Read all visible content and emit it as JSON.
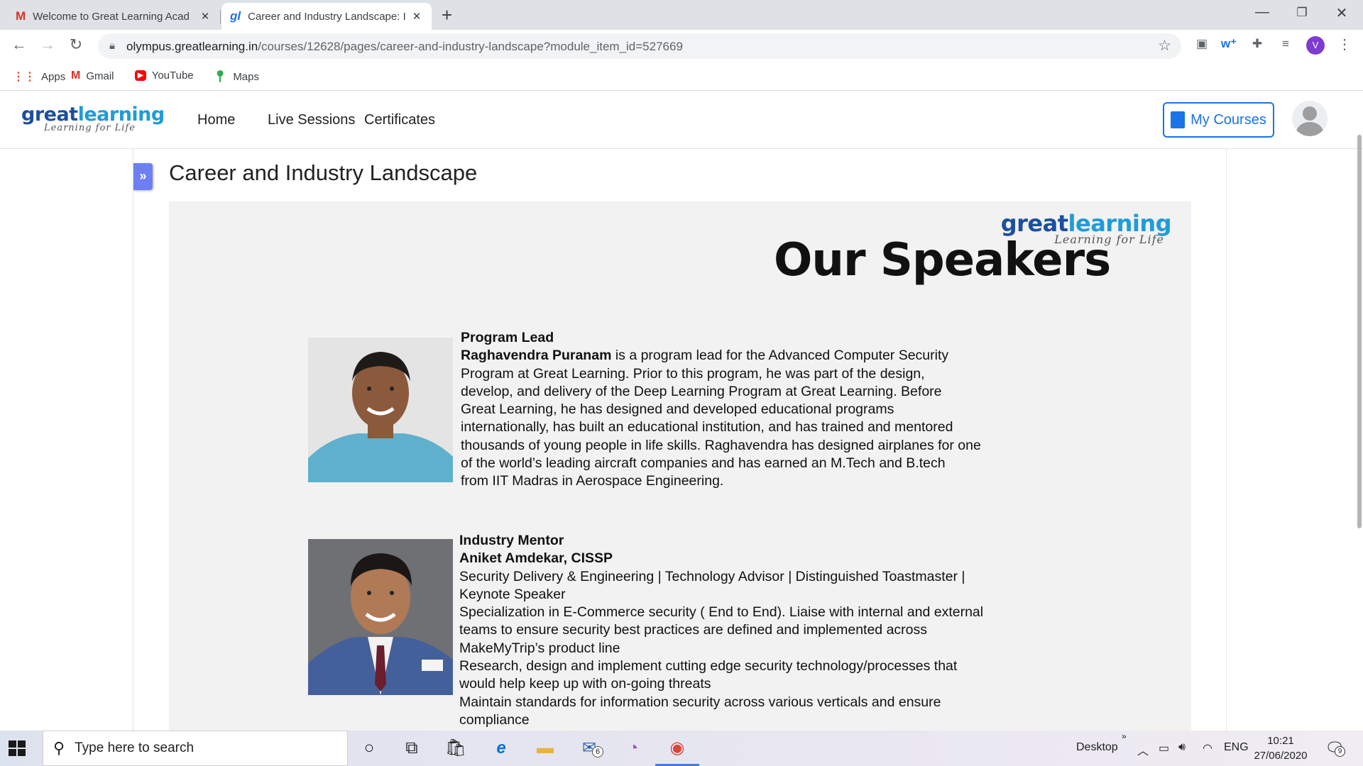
{
  "browser": {
    "tabs": [
      {
        "title": "Welcome to Great Learning Acad",
        "icon": "gmail-icon",
        "active": false
      },
      {
        "title": "Career and Industry Landscape: I",
        "icon": "greatlearning-icon",
        "active": true
      }
    ],
    "url_domain": "olympus.greatlearning.in",
    "url_path": "/courses/12628/pages/career-and-industry-landscape?module_item_id=527669",
    "profile_initial": "V",
    "bookmarks": [
      "Apps",
      "Gmail",
      "YouTube",
      "Maps"
    ]
  },
  "site": {
    "logo_main_a": "great",
    "logo_main_b": "learning",
    "logo_sub": "Learning for Life",
    "nav": [
      "Home",
      "Live Sessions",
      "Certificates"
    ],
    "my_courses": "My Courses"
  },
  "page": {
    "title": "Career and Industry Landscape",
    "slide": {
      "logo_main_a": "great",
      "logo_main_b": "learning",
      "logo_sub": "Learning for Life",
      "heading": "Our Speakers",
      "speakers": [
        {
          "role": "Program Lead",
          "name": "Raghavendra Puranam",
          "bio_lines": [
            " is a program lead for the Advanced Computer Security",
            "Program at Great Learning. Prior to this program, he was part of the design,",
            "develop, and delivery of the Deep Learning Program at Great Learning.  Before",
            "Great Learning, he has designed and developed educational programs",
            "internationally, has built an educational institution, and has trained and mentored",
            "thousands of young people in life skills. Raghavendra has designed airplanes for one",
            "of the world’s leading aircraft companies and has earned an M.Tech and B.tech",
            "from IIT Madras in Aerospace Engineering."
          ]
        },
        {
          "role": "Industry Mentor",
          "name": "Aniket Amdekar, CISSP",
          "bio_lines": [
            "Security Delivery & Engineering | Technology Advisor | Distinguished Toastmaster |",
            "Keynote Speaker",
            "Specialization in E-Commerce security ( End to End). Liaise with internal and external",
            "teams to ensure security best practices are defined and implemented across",
            "MakeMyTrip’s product line",
            "Research, design and implement cutting edge security technology/processes that",
            "would help keep up with on-going threats",
            "Maintain standards for information security across various verticals and ensure",
            "compliance"
          ]
        }
      ]
    }
  },
  "taskbar": {
    "search_placeholder": "Type here to search",
    "mail_badge": "6",
    "desktop_label": "Desktop",
    "language": "ENG",
    "time": "10:21",
    "date": "27/06/2020",
    "notification_count": "9"
  }
}
